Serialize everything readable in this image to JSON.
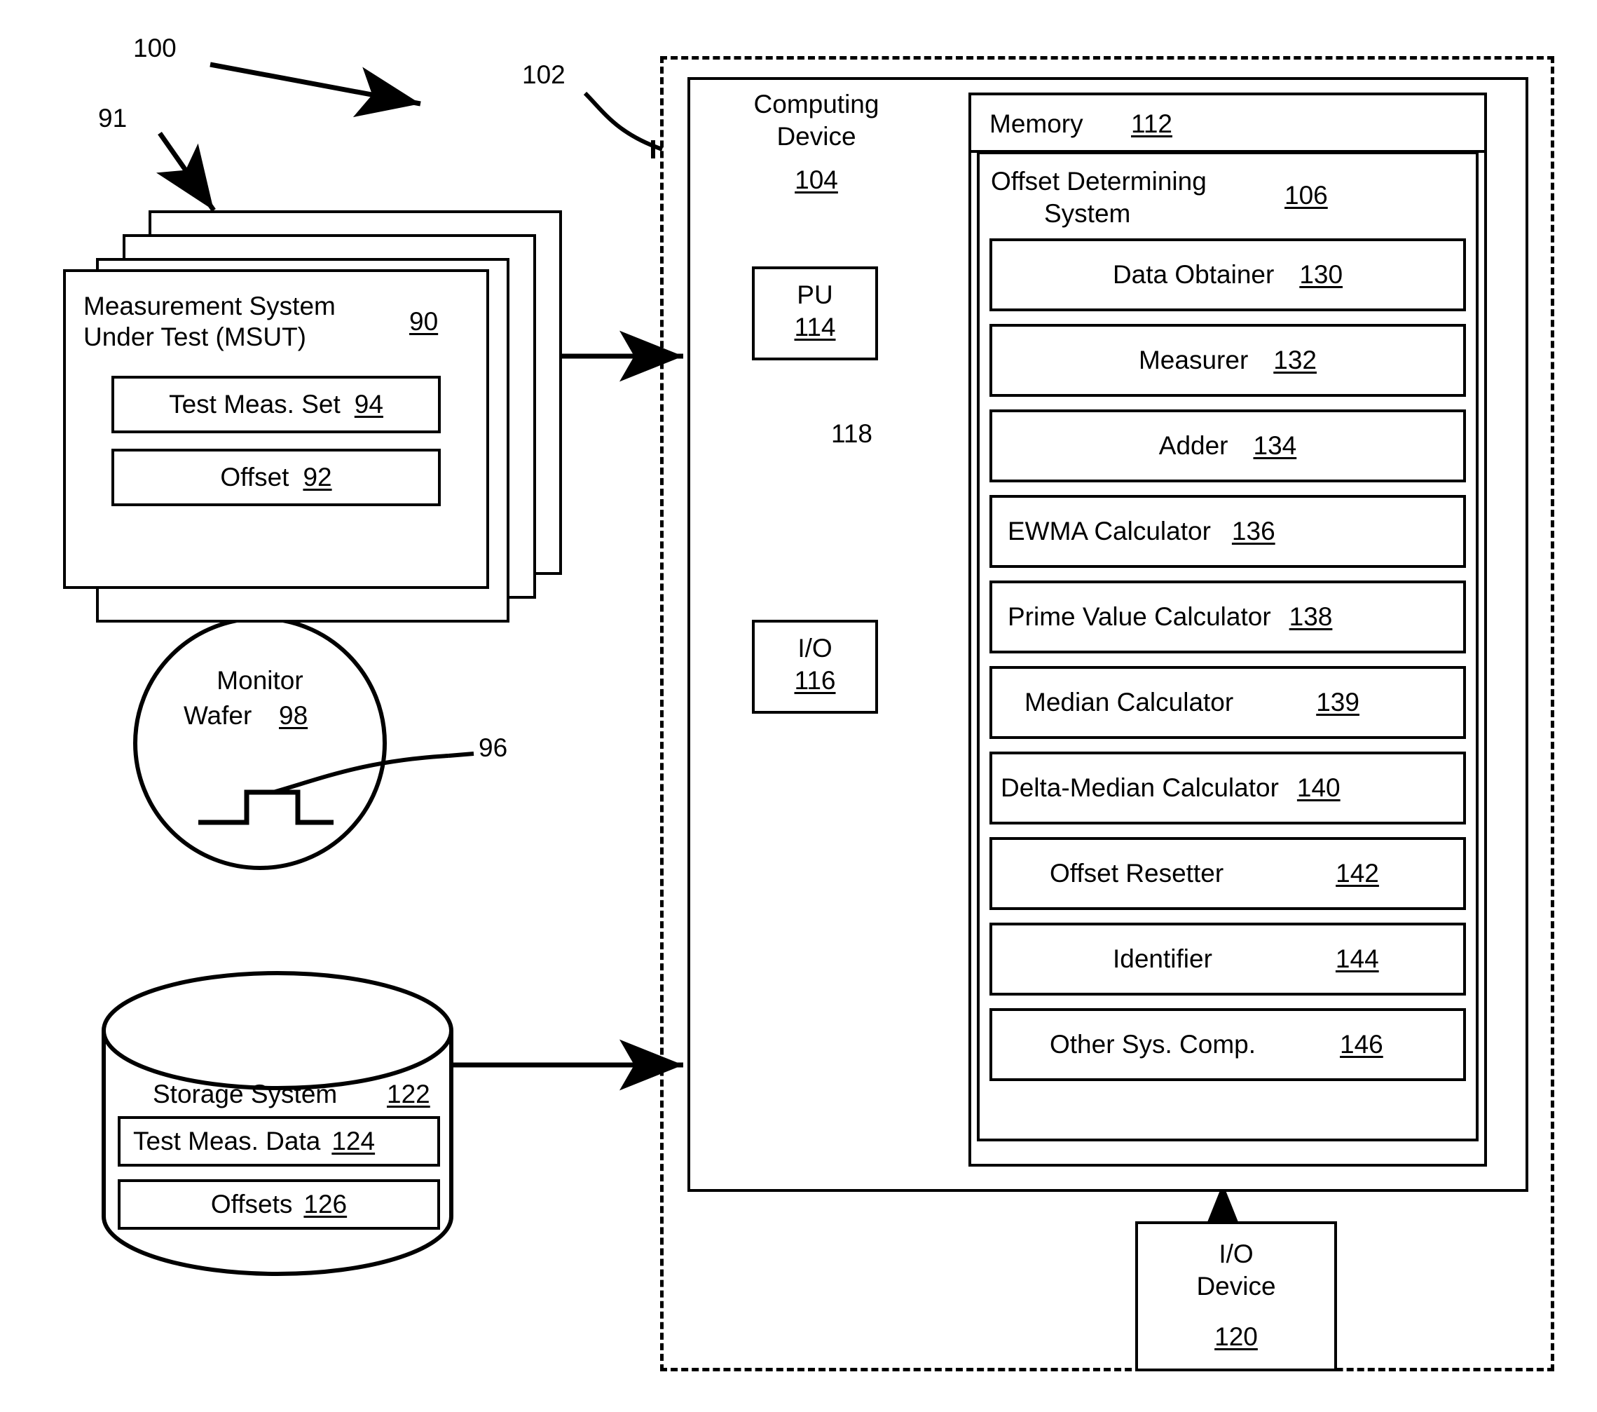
{
  "figure": {
    "ref_system": "100",
    "ref_environment": "102",
    "ref_stack": "91"
  },
  "msut": {
    "title_line1": "Measurement System",
    "title_line2": "Under Test (MSUT)",
    "ref": "90",
    "items": [
      {
        "label": "Test Meas. Set",
        "ref": "94"
      },
      {
        "label": "Offset",
        "ref": "92"
      }
    ]
  },
  "monitor_wafer": {
    "line1": "Monitor",
    "line2": "Wafer",
    "ref": "98",
    "feature_ref": "96"
  },
  "storage": {
    "title": "Storage System",
    "ref": "122",
    "items": [
      {
        "label": "Test Meas. Data",
        "ref": "124"
      },
      {
        "label": "Offsets",
        "ref": "126"
      }
    ]
  },
  "computing_device": {
    "line1": "Computing",
    "line2": "Device",
    "ref": "104",
    "pu": {
      "label": "PU",
      "ref": "114"
    },
    "io": {
      "label": "I/O",
      "ref": "116"
    },
    "bus_ref": "118"
  },
  "memory": {
    "label": "Memory",
    "ref": "112"
  },
  "offset_determining_system": {
    "title_line1": "Offset Determining",
    "title_line2": "System",
    "ref": "106",
    "components": [
      {
        "label": "Data Obtainer",
        "ref": "130",
        "align": "center"
      },
      {
        "label": "Measurer",
        "ref": "132",
        "align": "center"
      },
      {
        "label": "Adder",
        "ref": "134",
        "align": "center"
      },
      {
        "label": "EWMA Calculator",
        "ref": "136",
        "align": "left"
      },
      {
        "label": "Prime Value Calculator",
        "ref": "138",
        "align": "left"
      },
      {
        "label": "Median Calculator",
        "ref": "139",
        "align": "left"
      },
      {
        "label": "Delta-Median Calculator",
        "ref": "140",
        "align": "left"
      },
      {
        "label": "Offset Resetter",
        "ref": "142",
        "align": "center"
      },
      {
        "label": "Identifier",
        "ref": "144",
        "align": "center"
      },
      {
        "label": "Other Sys. Comp.",
        "ref": "146",
        "align": "center"
      }
    ]
  },
  "io_device": {
    "line1": "I/O",
    "line2": "Device",
    "ref": "120"
  },
  "colors": {
    "ink": "#000000",
    "paper": "#ffffff"
  }
}
